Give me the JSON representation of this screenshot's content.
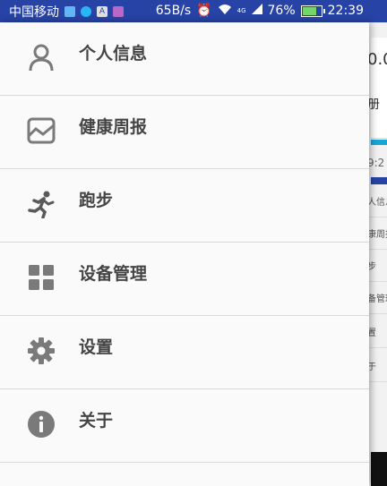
{
  "status_bar": {
    "carrier": "中国移动",
    "speed": "65B/s",
    "network": "4G",
    "battery": "76%",
    "time": "22:39"
  },
  "background_app": {
    "number_partial": "0.0",
    "tab_partial": "册",
    "time_partial": "9:2",
    "items_partial": [
      "人信息",
      "康周报",
      "步",
      "备管理",
      "置",
      "于"
    ]
  },
  "drawer": {
    "items": [
      {
        "label": "个人信息",
        "icon": "person-icon"
      },
      {
        "label": "健康周报",
        "icon": "report-chart-icon"
      },
      {
        "label": "跑步",
        "icon": "running-icon"
      },
      {
        "label": "设备管理",
        "icon": "grid-icon"
      },
      {
        "label": "设置",
        "icon": "gear-icon"
      },
      {
        "label": "关于",
        "icon": "info-icon"
      }
    ]
  },
  "colors": {
    "status_bar": "#2743a6",
    "drawer_bg": "#fafafa",
    "icon": "#7a7a7a",
    "label": "#444444"
  }
}
